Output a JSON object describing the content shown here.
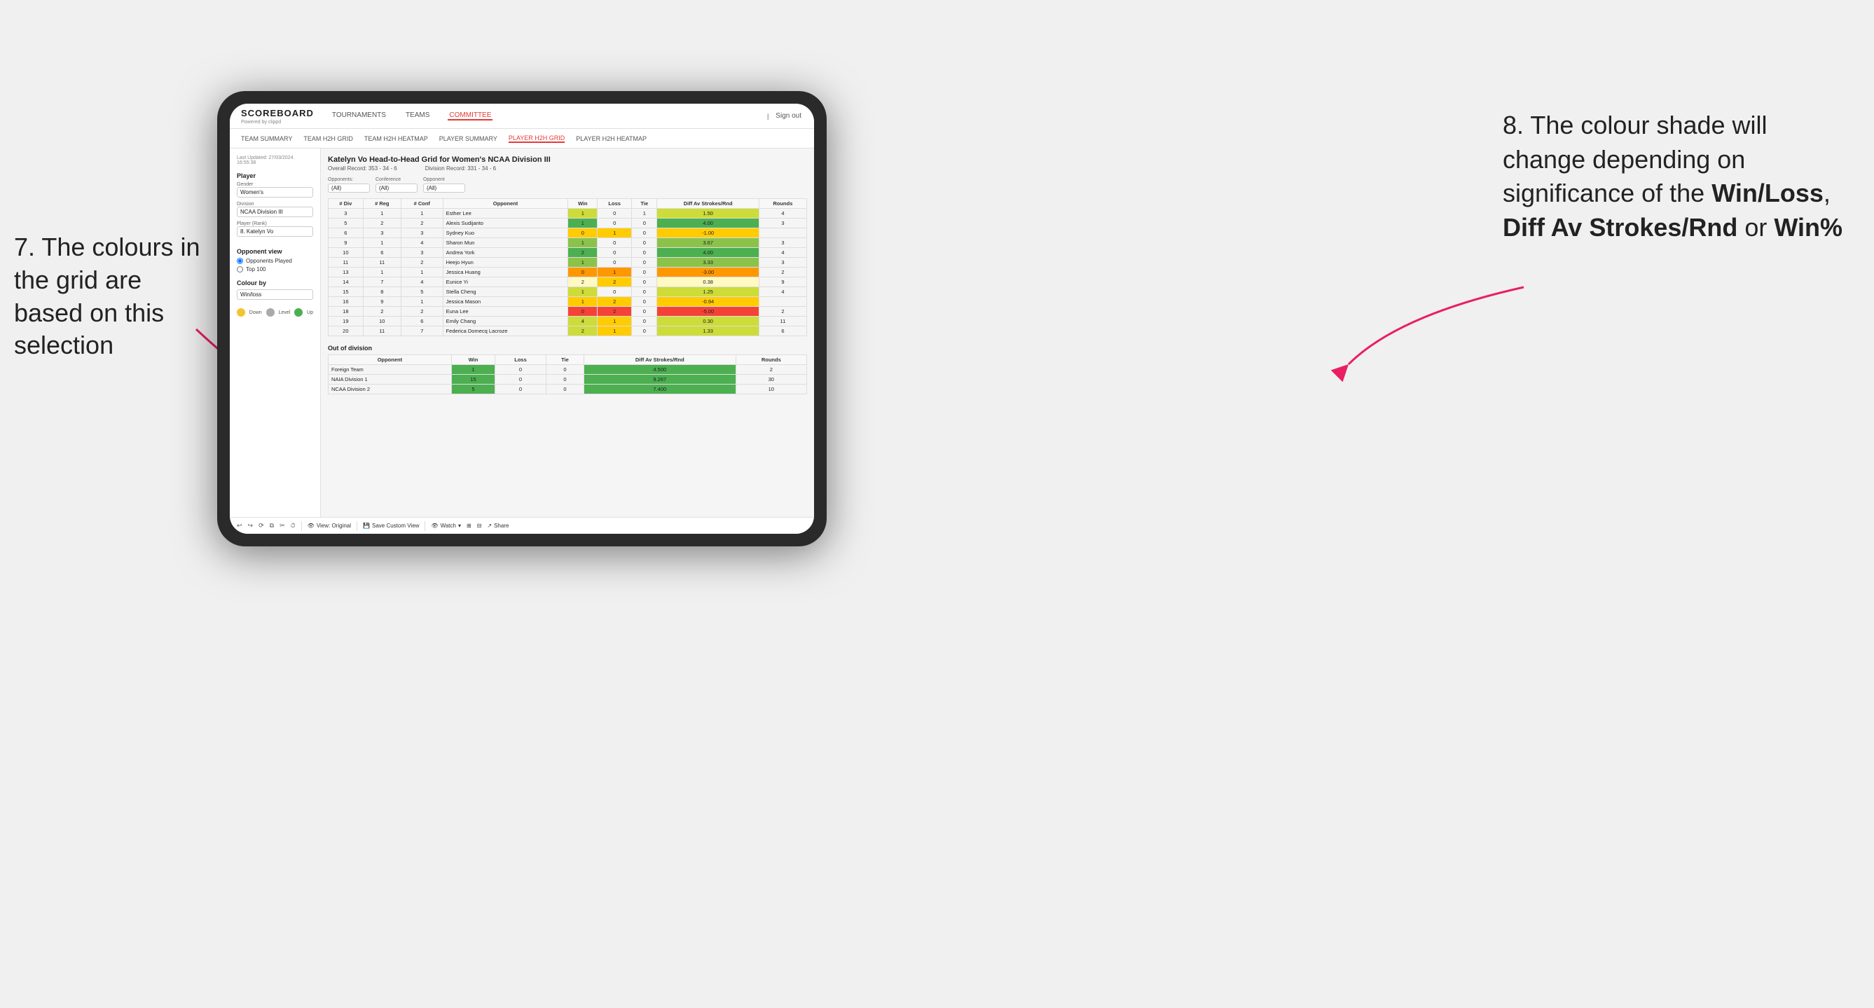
{
  "annotation_left": {
    "text": "7. The colours in the grid are based on this selection"
  },
  "annotation_right": {
    "line1": "8. The colour shade will change depending on significance of the ",
    "bold1": "Win/Loss",
    "sep1": ", ",
    "bold2": "Diff Av Strokes/Rnd",
    "sep2": " or ",
    "bold3": "Win%"
  },
  "header": {
    "logo": "SCOREBOARD",
    "logo_sub": "Powered by clippd",
    "nav": [
      "TOURNAMENTS",
      "TEAMS",
      "COMMITTEE"
    ],
    "active_nav": "COMMITTEE",
    "sign_out": "Sign out"
  },
  "sub_nav": {
    "items": [
      "TEAM SUMMARY",
      "TEAM H2H GRID",
      "TEAM H2H HEATMAP",
      "PLAYER SUMMARY",
      "PLAYER H2H GRID",
      "PLAYER H2H HEATMAP"
    ],
    "active": "PLAYER H2H GRID"
  },
  "sidebar": {
    "timestamp_label": "Last Updated: 27/03/2024",
    "timestamp_time": "16:55:38",
    "player_section": "Player",
    "gender_label": "Gender",
    "gender_value": "Women's",
    "division_label": "Division",
    "division_value": "NCAA Division III",
    "player_rank_label": "Player (Rank)",
    "player_rank_value": "8. Katelyn Vo",
    "opponent_view_label": "Opponent view",
    "radio_opponents": "Opponents Played",
    "radio_top100": "Top 100",
    "colour_by_label": "Colour by",
    "colour_by_value": "Win/loss",
    "legend_down": "Down",
    "legend_level": "Level",
    "legend_up": "Up"
  },
  "report": {
    "title": "Katelyn Vo Head-to-Head Grid for Women's NCAA Division III",
    "overall_record_label": "Overall Record:",
    "overall_record_value": "353 - 34 - 6",
    "division_record_label": "Division Record:",
    "division_record_value": "331 - 34 - 6",
    "filters": {
      "opponents_label": "Opponents:",
      "opponents_value": "(All)",
      "conference_label": "Conference",
      "conference_value": "(All)",
      "opponent_label": "Opponent",
      "opponent_value": "(All)"
    },
    "table": {
      "headers": [
        "# Div",
        "# Reg",
        "# Conf",
        "Opponent",
        "Win",
        "Loss",
        "Tie",
        "Diff Av Strokes/Rnd",
        "Rounds"
      ],
      "rows": [
        {
          "div": 3,
          "reg": 1,
          "conf": 1,
          "opponent": "Esther Lee",
          "win": 1,
          "loss": 0,
          "tie": 1,
          "diff": 1.5,
          "rounds": 4,
          "win_class": "win-light"
        },
        {
          "div": 5,
          "reg": 2,
          "conf": 2,
          "opponent": "Alexis Sudijanto",
          "win": 1,
          "loss": 0,
          "tie": 0,
          "diff": 4.0,
          "rounds": 3,
          "win_class": "win-strong"
        },
        {
          "div": 6,
          "reg": 3,
          "conf": 3,
          "opponent": "Sydney Kuo",
          "win": 0,
          "loss": 1,
          "tie": 0,
          "diff": -1.0,
          "rounds": "",
          "win_class": "loss-light"
        },
        {
          "div": 9,
          "reg": 1,
          "conf": 4,
          "opponent": "Sharon Mun",
          "win": 1,
          "loss": 0,
          "tie": 0,
          "diff": 3.67,
          "rounds": 3,
          "win_class": "win-medium"
        },
        {
          "div": 10,
          "reg": 6,
          "conf": 3,
          "opponent": "Andrea York",
          "win": 2,
          "loss": 0,
          "tie": 0,
          "diff": 4.0,
          "rounds": 4,
          "win_class": "win-strong"
        },
        {
          "div": 11,
          "reg": 11,
          "conf": 2,
          "opponent": "Heejo Hyun",
          "win": 1,
          "loss": 0,
          "tie": 0,
          "diff": 3.33,
          "rounds": 3,
          "win_class": "win-medium"
        },
        {
          "div": 13,
          "reg": 1,
          "conf": 1,
          "opponent": "Jessica Huang",
          "win": 0,
          "loss": 1,
          "tie": 0,
          "diff": -3.0,
          "rounds": 2,
          "win_class": "loss-medium"
        },
        {
          "div": 14,
          "reg": 7,
          "conf": 4,
          "opponent": "Eunice Yi",
          "win": 2,
          "loss": 2,
          "tie": 0,
          "diff": 0.38,
          "rounds": 9,
          "win_class": "neutral"
        },
        {
          "div": 15,
          "reg": 8,
          "conf": 5,
          "opponent": "Stella Cheng",
          "win": 1,
          "loss": 0,
          "tie": 0,
          "diff": 1.25,
          "rounds": 4,
          "win_class": "win-light"
        },
        {
          "div": 16,
          "reg": 9,
          "conf": 1,
          "opponent": "Jessica Mason",
          "win": 1,
          "loss": 2,
          "tie": 0,
          "diff": -0.94,
          "rounds": "",
          "win_class": "loss-light"
        },
        {
          "div": 18,
          "reg": 2,
          "conf": 2,
          "opponent": "Euna Lee",
          "win": 0,
          "loss": 2,
          "tie": 0,
          "diff": -5.0,
          "rounds": 2,
          "win_class": "loss-strong"
        },
        {
          "div": 19,
          "reg": 10,
          "conf": 6,
          "opponent": "Emily Chang",
          "win": 4,
          "loss": 1,
          "tie": 0,
          "diff": 0.3,
          "rounds": 11,
          "win_class": "win-light"
        },
        {
          "div": 20,
          "reg": 11,
          "conf": 7,
          "opponent": "Federica Domecq Lacroze",
          "win": 2,
          "loss": 1,
          "tie": 0,
          "diff": 1.33,
          "rounds": 6,
          "win_class": "win-light"
        }
      ]
    },
    "out_of_division": {
      "label": "Out of division",
      "rows": [
        {
          "opponent": "Foreign Team",
          "win": 1,
          "loss": 0,
          "tie": 0,
          "diff": 4.5,
          "rounds": 2,
          "win_class": "win-strong"
        },
        {
          "opponent": "NAIA Division 1",
          "win": 15,
          "loss": 0,
          "tie": 0,
          "diff": 9.267,
          "rounds": 30,
          "win_class": "win-strong"
        },
        {
          "opponent": "NCAA Division 2",
          "win": 5,
          "loss": 0,
          "tie": 0,
          "diff": 7.4,
          "rounds": 10,
          "win_class": "win-strong"
        }
      ]
    }
  },
  "toolbar": {
    "view_original": "View: Original",
    "save_custom": "Save Custom View",
    "watch": "Watch",
    "share": "Share"
  },
  "colors": {
    "win_strong": "#4caf50",
    "win_medium": "#8bc34a",
    "win_light": "#cddc39",
    "neutral": "#fff9c4",
    "loss_light": "#ffeb3b",
    "loss_medium": "#ff9800",
    "loss_strong": "#f44336",
    "legend_down": "#f4c430",
    "legend_level": "#aaaaaa",
    "legend_up": "#4caf50"
  }
}
